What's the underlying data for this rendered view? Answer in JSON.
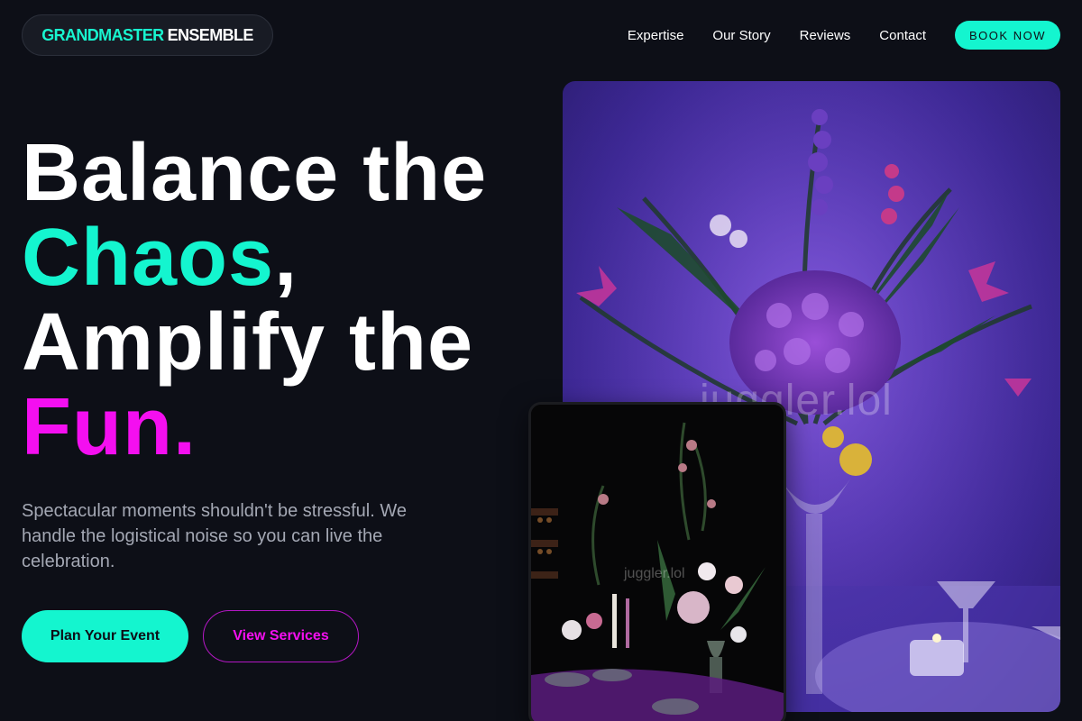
{
  "brand": {
    "accent": "GRANDMASTER",
    "main": "ENSEMBLE"
  },
  "nav": {
    "items": [
      "Expertise",
      "Our Story",
      "Reviews",
      "Contact"
    ],
    "cta": "BOOK NOW"
  },
  "hero": {
    "line1": "Balance the",
    "line2_accent": "Chaos",
    "line2_punct": ",",
    "line3": "Amplify the",
    "line4_accent": "Fun",
    "line4_punct": ".",
    "subtitle": "Spectacular moments shouldn't be stressful. We handle the logistical noise so you can live the celebration.",
    "primary_button": "Plan Your Event",
    "secondary_button": "View Services"
  },
  "images": {
    "main_watermark": "juggler.lol",
    "small_watermark": "juggler.lol"
  },
  "colors": {
    "background": "#0d0f17",
    "teal": "#14f5cf",
    "magenta": "#f40ff0",
    "muted_text": "#a4a8b4"
  },
  "icons": {
    "main_photo": "floral-centerpiece-image",
    "small_photo": "dark-table-floral-image"
  }
}
